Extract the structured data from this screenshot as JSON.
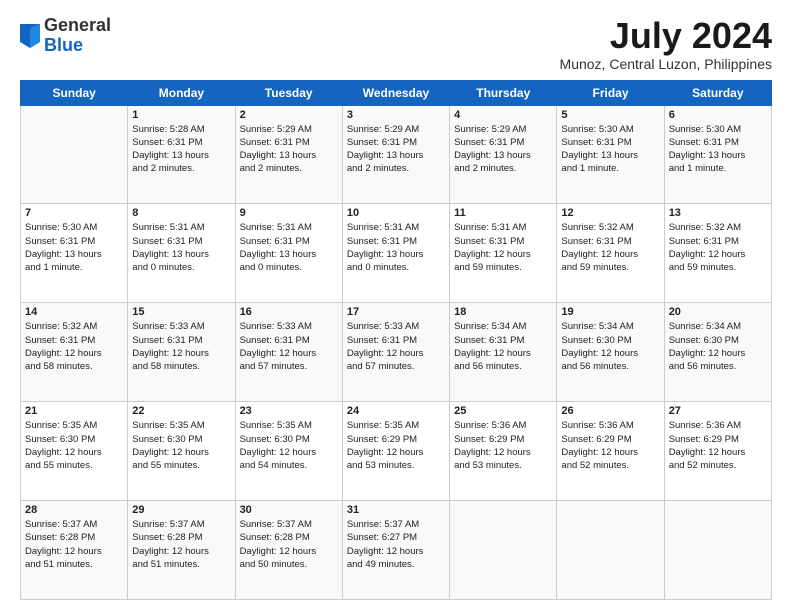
{
  "logo": {
    "general": "General",
    "blue": "Blue"
  },
  "header": {
    "month": "July 2024",
    "location": "Munoz, Central Luzon, Philippines"
  },
  "weekdays": [
    "Sunday",
    "Monday",
    "Tuesday",
    "Wednesday",
    "Thursday",
    "Friday",
    "Saturday"
  ],
  "weeks": [
    [
      {
        "day": "",
        "content": ""
      },
      {
        "day": "1",
        "content": "Sunrise: 5:28 AM\nSunset: 6:31 PM\nDaylight: 13 hours\nand 2 minutes."
      },
      {
        "day": "2",
        "content": "Sunrise: 5:29 AM\nSunset: 6:31 PM\nDaylight: 13 hours\nand 2 minutes."
      },
      {
        "day": "3",
        "content": "Sunrise: 5:29 AM\nSunset: 6:31 PM\nDaylight: 13 hours\nand 2 minutes."
      },
      {
        "day": "4",
        "content": "Sunrise: 5:29 AM\nSunset: 6:31 PM\nDaylight: 13 hours\nand 2 minutes."
      },
      {
        "day": "5",
        "content": "Sunrise: 5:30 AM\nSunset: 6:31 PM\nDaylight: 13 hours\nand 1 minute."
      },
      {
        "day": "6",
        "content": "Sunrise: 5:30 AM\nSunset: 6:31 PM\nDaylight: 13 hours\nand 1 minute."
      }
    ],
    [
      {
        "day": "7",
        "content": "Sunrise: 5:30 AM\nSunset: 6:31 PM\nDaylight: 13 hours\nand 1 minute."
      },
      {
        "day": "8",
        "content": "Sunrise: 5:31 AM\nSunset: 6:31 PM\nDaylight: 13 hours\nand 0 minutes."
      },
      {
        "day": "9",
        "content": "Sunrise: 5:31 AM\nSunset: 6:31 PM\nDaylight: 13 hours\nand 0 minutes."
      },
      {
        "day": "10",
        "content": "Sunrise: 5:31 AM\nSunset: 6:31 PM\nDaylight: 13 hours\nand 0 minutes."
      },
      {
        "day": "11",
        "content": "Sunrise: 5:31 AM\nSunset: 6:31 PM\nDaylight: 12 hours\nand 59 minutes."
      },
      {
        "day": "12",
        "content": "Sunrise: 5:32 AM\nSunset: 6:31 PM\nDaylight: 12 hours\nand 59 minutes."
      },
      {
        "day": "13",
        "content": "Sunrise: 5:32 AM\nSunset: 6:31 PM\nDaylight: 12 hours\nand 59 minutes."
      }
    ],
    [
      {
        "day": "14",
        "content": "Sunrise: 5:32 AM\nSunset: 6:31 PM\nDaylight: 12 hours\nand 58 minutes."
      },
      {
        "day": "15",
        "content": "Sunrise: 5:33 AM\nSunset: 6:31 PM\nDaylight: 12 hours\nand 58 minutes."
      },
      {
        "day": "16",
        "content": "Sunrise: 5:33 AM\nSunset: 6:31 PM\nDaylight: 12 hours\nand 57 minutes."
      },
      {
        "day": "17",
        "content": "Sunrise: 5:33 AM\nSunset: 6:31 PM\nDaylight: 12 hours\nand 57 minutes."
      },
      {
        "day": "18",
        "content": "Sunrise: 5:34 AM\nSunset: 6:31 PM\nDaylight: 12 hours\nand 56 minutes."
      },
      {
        "day": "19",
        "content": "Sunrise: 5:34 AM\nSunset: 6:30 PM\nDaylight: 12 hours\nand 56 minutes."
      },
      {
        "day": "20",
        "content": "Sunrise: 5:34 AM\nSunset: 6:30 PM\nDaylight: 12 hours\nand 56 minutes."
      }
    ],
    [
      {
        "day": "21",
        "content": "Sunrise: 5:35 AM\nSunset: 6:30 PM\nDaylight: 12 hours\nand 55 minutes."
      },
      {
        "day": "22",
        "content": "Sunrise: 5:35 AM\nSunset: 6:30 PM\nDaylight: 12 hours\nand 55 minutes."
      },
      {
        "day": "23",
        "content": "Sunrise: 5:35 AM\nSunset: 6:30 PM\nDaylight: 12 hours\nand 54 minutes."
      },
      {
        "day": "24",
        "content": "Sunrise: 5:35 AM\nSunset: 6:29 PM\nDaylight: 12 hours\nand 53 minutes."
      },
      {
        "day": "25",
        "content": "Sunrise: 5:36 AM\nSunset: 6:29 PM\nDaylight: 12 hours\nand 53 minutes."
      },
      {
        "day": "26",
        "content": "Sunrise: 5:36 AM\nSunset: 6:29 PM\nDaylight: 12 hours\nand 52 minutes."
      },
      {
        "day": "27",
        "content": "Sunrise: 5:36 AM\nSunset: 6:29 PM\nDaylight: 12 hours\nand 52 minutes."
      }
    ],
    [
      {
        "day": "28",
        "content": "Sunrise: 5:37 AM\nSunset: 6:28 PM\nDaylight: 12 hours\nand 51 minutes."
      },
      {
        "day": "29",
        "content": "Sunrise: 5:37 AM\nSunset: 6:28 PM\nDaylight: 12 hours\nand 51 minutes."
      },
      {
        "day": "30",
        "content": "Sunrise: 5:37 AM\nSunset: 6:28 PM\nDaylight: 12 hours\nand 50 minutes."
      },
      {
        "day": "31",
        "content": "Sunrise: 5:37 AM\nSunset: 6:27 PM\nDaylight: 12 hours\nand 49 minutes."
      },
      {
        "day": "",
        "content": ""
      },
      {
        "day": "",
        "content": ""
      },
      {
        "day": "",
        "content": ""
      }
    ]
  ]
}
